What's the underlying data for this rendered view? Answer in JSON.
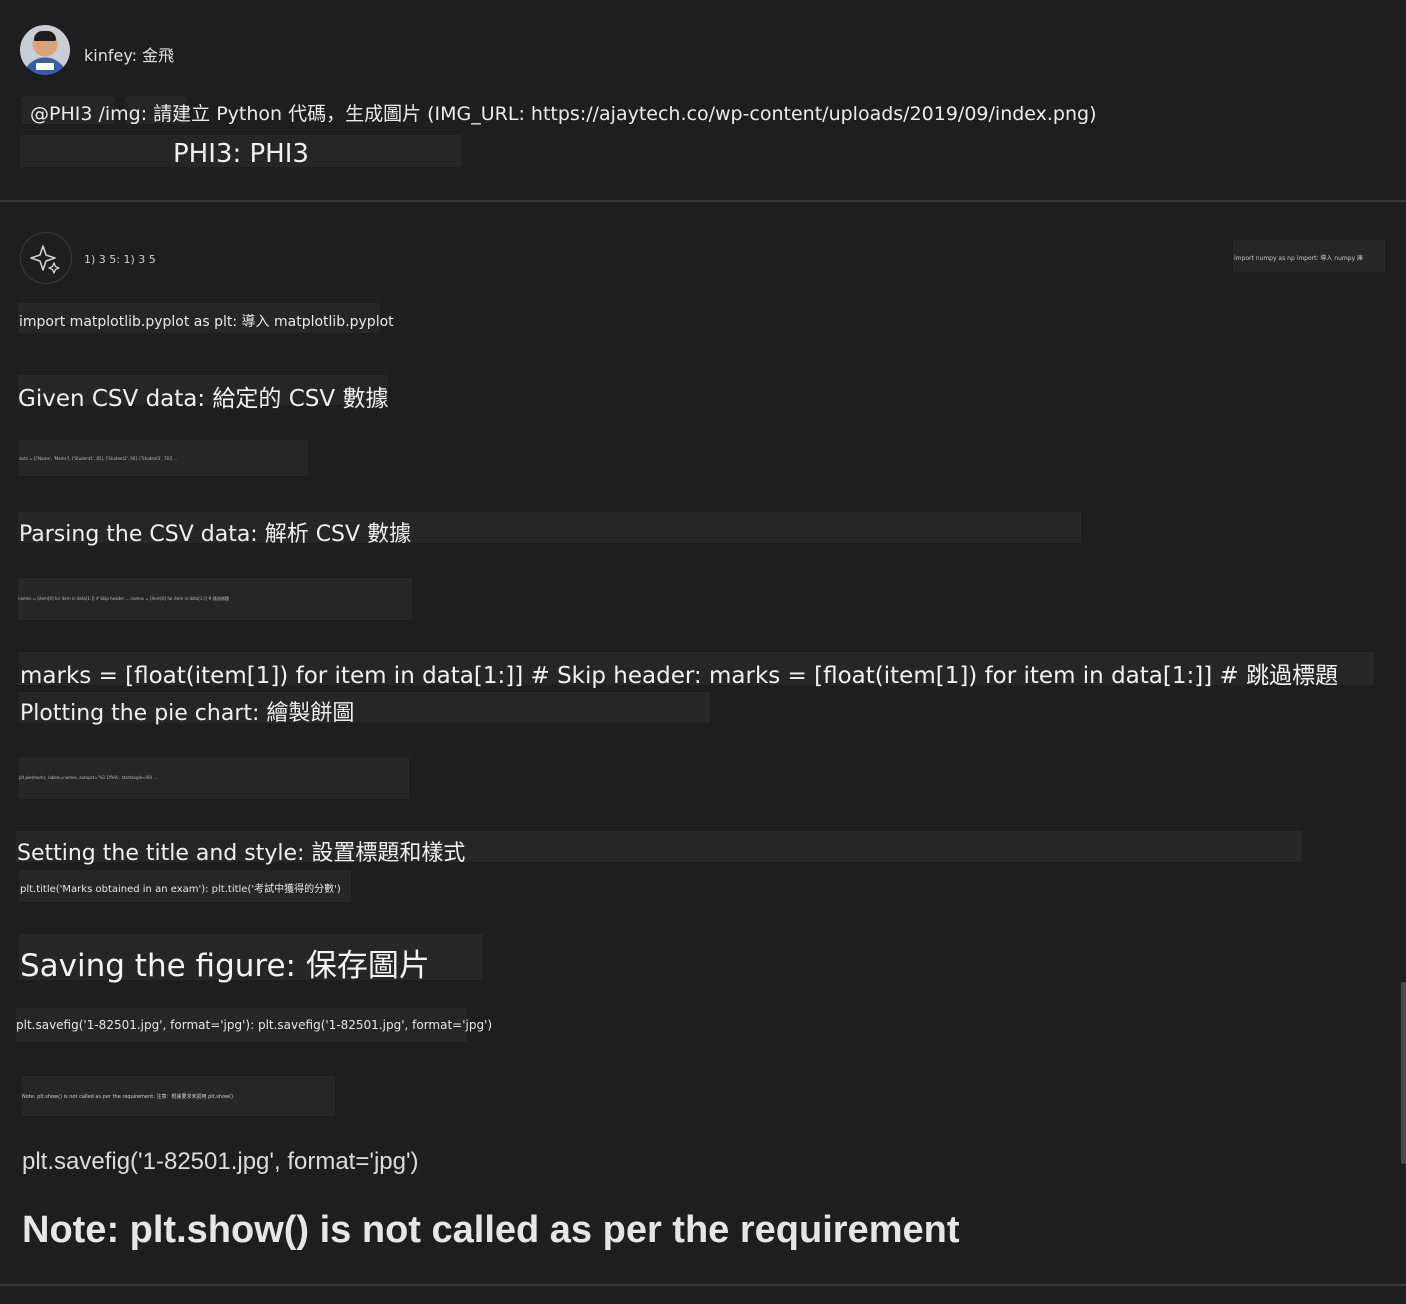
{
  "user": {
    "name": "kinfey: 金飛",
    "prompt": "@PHI3 /img: 請建立 Python 代碼，生成圖片 (IMG_URL: https://ajaytech.co/wp-content/uploads/2019/09/index.png)",
    "agent_tag": "PHI3: PHI3"
  },
  "assistant": {
    "header": "1) 3 5: 1) 3 5",
    "import_numpy": "import numpy as np import: 導入 numpy 庫",
    "lines": [
      "import matplotlib.pyplot as plt: 導入 matplotlib.pyplot",
      "Given CSV data: 給定的 CSV 數據",
      "data = [['Name', 'Marks'], ['Student1', 85], ['Student2', 90], ['Student3', 78]] ...",
      "Parsing the CSV data: 解析 CSV 數據",
      "names = [item[0] for item in data[1:]] # Skip header ... names = [item[0] for item in data[1:]] # 跳過標題",
      "marks = [float(item[1]) for item in data[1:]] # Skip header: marks = [float(item[1]) for item in data[1:]] # 跳過標題",
      "Plotting the pie chart: 繪製餅圖",
      "plt.pie(marks, labels=names, autopct='%1.1f%%', startangle=90) ...",
      "Setting the title and style: 設置標題和樣式",
      "plt.title('Marks obtained in an exam'): plt.title('考試中獲得的分數')",
      "Saving the figure: 保存圖片",
      "plt.savefig('1-82501.jpg', format='jpg'): plt.savefig('1-82501.jpg', format='jpg')",
      "Note: plt.show() is not called as per the requirement: 注意：根據要求未調用 plt.show()",
      "plt.savefig('1-82501.jpg', format='jpg')",
      "Note: plt.show() is not called as per the requirement"
    ]
  },
  "colors": {
    "background": "#1e1e1e",
    "block": "#262626",
    "text": "#e8e8e8"
  }
}
